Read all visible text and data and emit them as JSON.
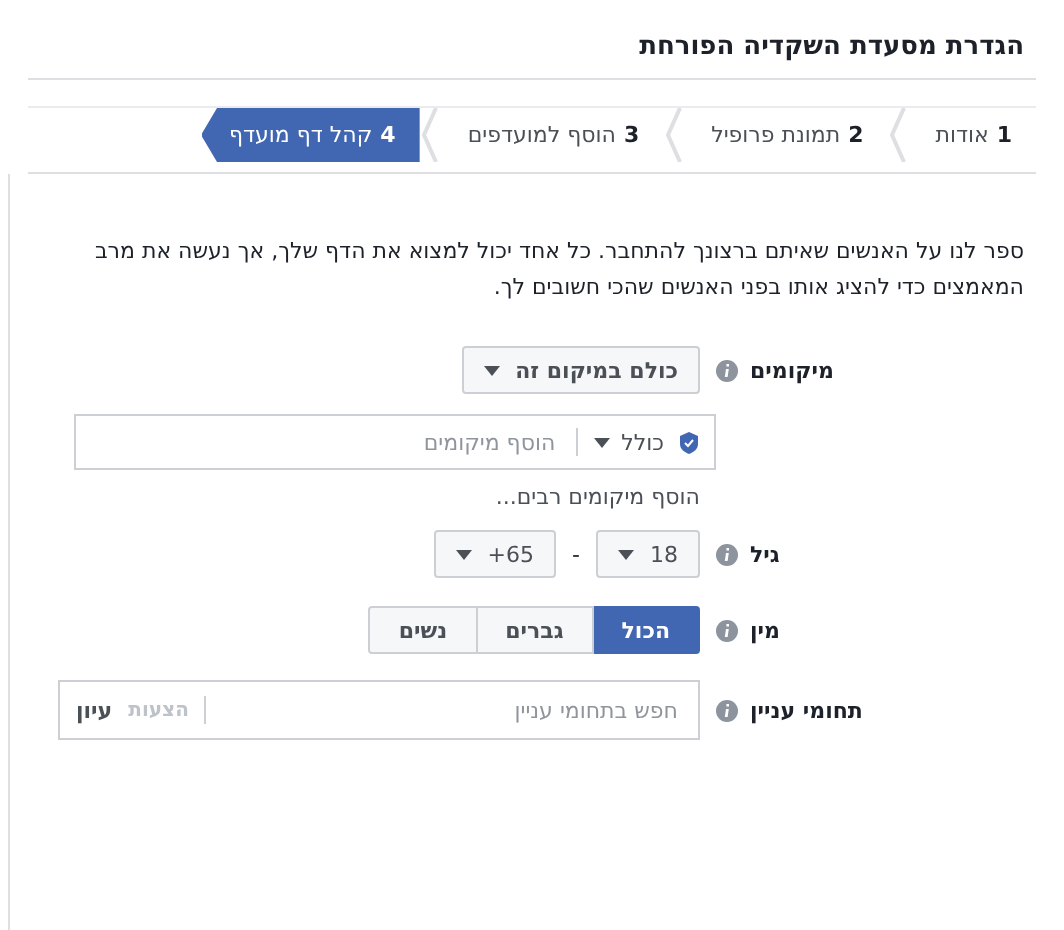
{
  "title": "הגדרת מסעדת השקדיה הפורחת",
  "tabs": [
    {
      "number": "1",
      "label": "אודות",
      "selected": false
    },
    {
      "number": "2",
      "label": "תמונת פרופיל",
      "selected": false
    },
    {
      "number": "3",
      "label": "הוסף למועדפים",
      "selected": false
    },
    {
      "number": "4",
      "label": "קהל דף מועדף",
      "selected": true
    }
  ],
  "description": "ספר לנו על האנשים שאיתם ברצונך להתחבר. כל אחד יכול למצוא את הדף שלך, אך נעשה את מרב המאמצים כדי להציג אותו בפני האנשים שהכי חשובים לך.",
  "locations": {
    "label": "מיקומים",
    "scope": "כולם במיקום זה",
    "include": "כולל",
    "placeholder": "הוסף מיקומים",
    "bulk_link": "הוסף מיקומים רבים..."
  },
  "age": {
    "label": "גיל",
    "min": "18",
    "separator": "-",
    "max": "+65"
  },
  "gender": {
    "label": "מין",
    "options": [
      {
        "label": "הכול",
        "selected": true
      },
      {
        "label": "גברים",
        "selected": false
      },
      {
        "label": "נשים",
        "selected": false
      }
    ]
  },
  "interests": {
    "label": "תחומי עניין",
    "placeholder": "חפש בתחומי עניין",
    "suggestions": "הצעות",
    "browse": "עיון"
  }
}
